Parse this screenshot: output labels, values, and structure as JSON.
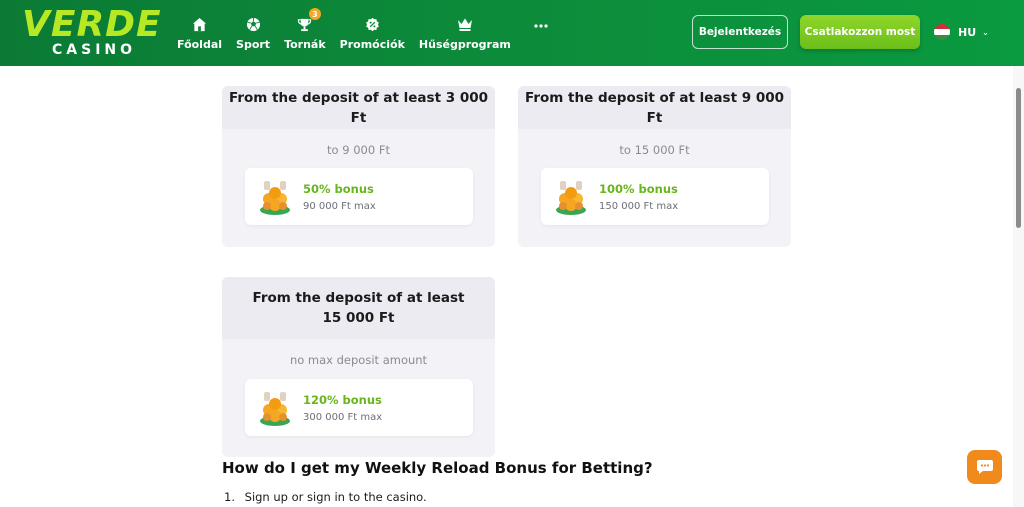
{
  "header": {
    "logo_top": "VERDE",
    "logo_bottom": "CASINO",
    "nav": [
      {
        "label": "Főoldal",
        "icon": "home-icon"
      },
      {
        "label": "Sport",
        "icon": "soccer-ball-icon"
      },
      {
        "label": "Tornák",
        "icon": "trophy-icon",
        "badge": "3"
      },
      {
        "label": "Promóciók",
        "icon": "percent-icon"
      },
      {
        "label": "Hűségprogram",
        "icon": "crown-icon"
      }
    ],
    "more_icon": "more-dots-icon",
    "login_label": "Bejelentkezés",
    "join_label": "Csatlakozzon most",
    "language": "HU",
    "colors": {
      "brand_green": "#0c8a3a",
      "logo_lime": "#b7e824",
      "cta_green": "#7ccb22"
    }
  },
  "cards": [
    {
      "title": "From the deposit of at least 3 000 Ft",
      "range": "to 9 000 Ft",
      "bonus": "50% bonus",
      "max": "90 000 Ft max"
    },
    {
      "title": "From the deposit of at least 9 000 Ft",
      "range": "to 15 000 Ft",
      "bonus": "100% bonus",
      "max": "150 000 Ft max"
    },
    {
      "title_line1": "From the deposit of at least",
      "title_line2": "15 000 Ft",
      "range": "no max deposit amount",
      "bonus": "120% bonus",
      "max": "300 000 Ft max"
    }
  ],
  "section": {
    "title": "How do I get my Weekly Reload Bonus for Betting?",
    "steps": [
      {
        "number": "1.",
        "text": "Sign up or sign in to the casino."
      }
    ]
  },
  "chat": {
    "icon": "chat-bubble-icon",
    "color": "#f08a1c"
  },
  "bonus_icon": "orange-fruit-basket-icon"
}
